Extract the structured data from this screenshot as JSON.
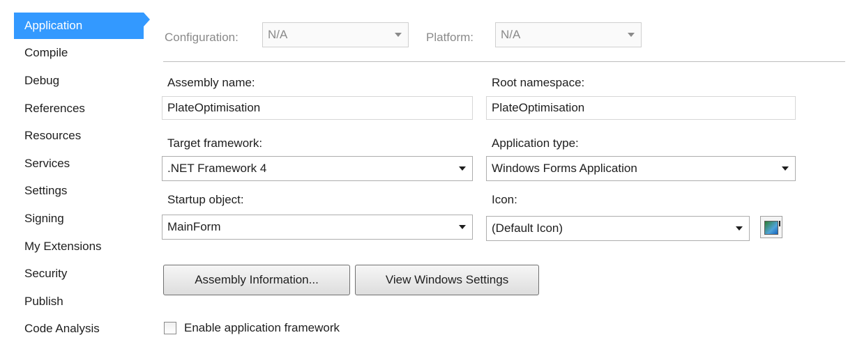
{
  "sidebar": {
    "items": [
      {
        "label": "Application",
        "active": true
      },
      {
        "label": "Compile"
      },
      {
        "label": "Debug"
      },
      {
        "label": "References"
      },
      {
        "label": "Resources"
      },
      {
        "label": "Services"
      },
      {
        "label": "Settings"
      },
      {
        "label": "Signing"
      },
      {
        "label": "My Extensions"
      },
      {
        "label": "Security"
      },
      {
        "label": "Publish"
      },
      {
        "label": "Code Analysis"
      }
    ],
    "accent_color": "#3399ff"
  },
  "config_bar": {
    "configuration_label": "Configuration:",
    "configuration_value": "N/A",
    "platform_label": "Platform:",
    "platform_value": "N/A"
  },
  "form": {
    "assembly_name_label": "Assembly name:",
    "assembly_name_value": "PlateOptimisation",
    "root_namespace_label": "Root namespace:",
    "root_namespace_value": "PlateOptimisation",
    "target_framework_label": "Target framework:",
    "target_framework_value": ".NET Framework 4",
    "application_type_label": "Application type:",
    "application_type_value": "Windows Forms Application",
    "startup_object_label": "Startup object:",
    "startup_object_value": "MainForm",
    "icon_label": "Icon:",
    "icon_value": "(Default Icon)",
    "icon_preview": "application-window-icon"
  },
  "buttons": {
    "assembly_information": "Assembly Information...",
    "view_windows_settings": "View Windows Settings"
  },
  "checkbox": {
    "enable_app_framework_label": "Enable application framework",
    "checked": false
  }
}
